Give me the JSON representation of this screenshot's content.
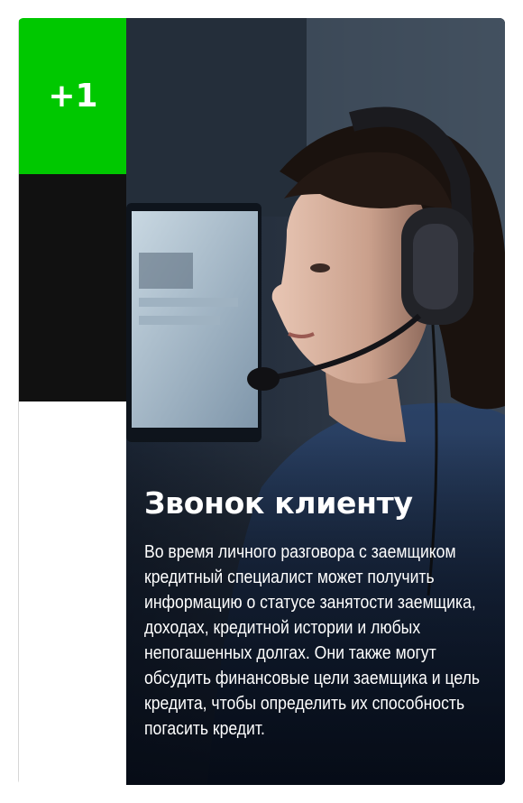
{
  "card": {
    "badge_text": "+1",
    "title": "Звонок клиенту",
    "description": "Во время личного разговора с заемщиком кредитный специалист может получить информацию о статусе занятости заемщика, доходах, кредитной истории и любых непогашенных долгах. Они также могут обсудить финансовые цели заемщика и цель кредита, чтобы определить их способность погасить кредит."
  },
  "colors": {
    "badge_green": "#00c800",
    "black_block": "#111111",
    "text": "#ffffff"
  },
  "icons": [
    "call-center-operator-photo"
  ]
}
